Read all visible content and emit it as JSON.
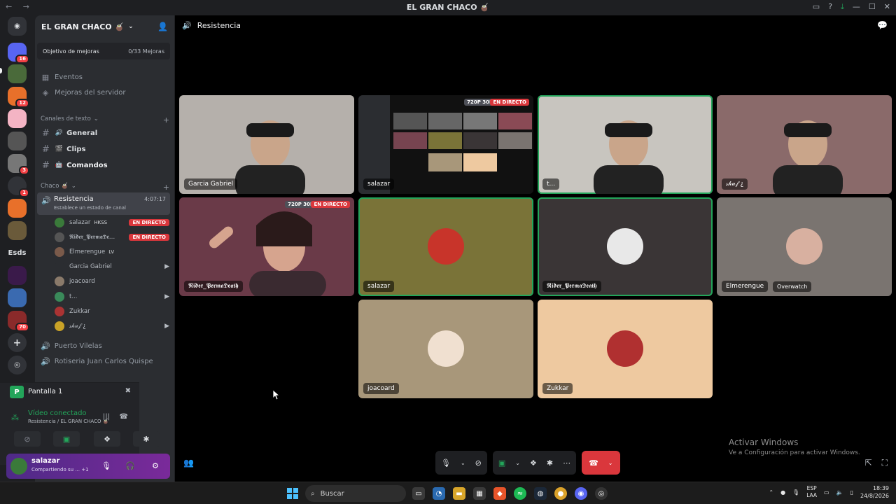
{
  "window": {
    "title": "EL GRAN CHACO 🧉",
    "nav": "← →"
  },
  "rail": {
    "badges": [
      "16",
      "12",
      "3",
      "1",
      "70"
    ],
    "text_server": "Esds"
  },
  "guild": {
    "name": "EL GRAN CHACO 🧉",
    "boost_label": "Objetivo de mejoras",
    "boost_progress": "0/33 Mejoras"
  },
  "sidebar": {
    "events": "Eventos",
    "boosts": "Mejoras del servidor",
    "text_category": "Canales de texto",
    "text_channels": [
      {
        "emoji": "🔊",
        "name": "General"
      },
      {
        "emoji": "🎬",
        "name": "Clips"
      },
      {
        "emoji": "🤖",
        "name": "Comandos"
      }
    ],
    "voice_category": "Chaco 🧉",
    "active_voice": {
      "name": "Resistencia",
      "status": "Establece un estado de canal",
      "timer": "4:07:17"
    },
    "members": [
      {
        "name": "salazar",
        "extra": "HKSS",
        "state": "EN DIRECTO",
        "color": "#3a7a3a"
      },
      {
        "name": "𝕽𝖎𝖉𝖊𝖗_𝕻𝖊𝖗𝖒𝖆𝕯𝖊…",
        "extra": "",
        "state": "EN DIRECTO",
        "color": "#555"
      },
      {
        "name": "Elmerengue",
        "extra": "LV",
        "state": "",
        "color": "#7a5a4a"
      },
      {
        "name": "Garcia Gabriel",
        "extra": "",
        "state": "cam",
        "color": "#2b2d31"
      },
      {
        "name": "joacoard",
        "extra": "",
        "state": "",
        "color": "#8a7a6a"
      },
      {
        "name": "t...",
        "extra": "",
        "state": "cam",
        "color": "#3a8a5a"
      },
      {
        "name": "Zukkar",
        "extra": "",
        "state": "",
        "color": "#a33"
      },
      {
        "name": "𝓈𝒽𝓊𝒻 ¿",
        "extra": "",
        "state": "cam",
        "color": "#c9a227"
      }
    ],
    "other_voice": [
      "Puerto Vilelas",
      "Rotiseria Juan Carlos Quispe"
    ]
  },
  "screen_panel": {
    "letter": "P",
    "label": "Pantalla 1"
  },
  "voice_panel": {
    "status": "Vídeo conectado",
    "location": "Resistencia / EL GRAN CHACO 🧉"
  },
  "user": {
    "name": "salazar",
    "status": "Compartiendo su ...",
    "extra": "+1"
  },
  "stage": {
    "channel": "Resistencia",
    "tiles": [
      {
        "name": "Garcia Gabriel",
        "kind": "cam",
        "bg": "#b5b0ab"
      },
      {
        "name": "salazar",
        "kind": "stream",
        "quality": "720P 30FPS",
        "live": "EN DIRECTO",
        "bg": "#111"
      },
      {
        "name": "t...",
        "kind": "cam",
        "bg": "#c8c5bf"
      },
      {
        "name": "𝓈𝒽𝓊𝒻 ¿",
        "kind": "cam",
        "bg": "#8a6a6a"
      },
      {
        "name": "𝕽𝖎𝖉𝖊𝖗_𝕻𝖊𝖗𝖒𝖆𝕯𝖊𝖆𝖙𝖍",
        "kind": "stream",
        "quality": "720P 30FPS",
        "live": "EN DIRECTO",
        "bg": "#6a3a48"
      },
      {
        "name": "salazar",
        "kind": "avatar",
        "bg": "#7a7338"
      },
      {
        "name": "𝕽𝖎𝖉𝖊𝖗_𝕻𝖊𝖗𝖒𝖆𝕯𝖊𝖆𝖙𝖍",
        "kind": "avatar",
        "bg": "#3a3536"
      },
      {
        "name": "Elmerengue",
        "kind": "avatar",
        "activity": "Overwatch",
        "bg": "#7a7470"
      },
      {
        "name": "joacoard",
        "kind": "avatar",
        "bg": "#a8977a"
      },
      {
        "name": "Zukkar",
        "kind": "avatar",
        "bg": "#eec9a0"
      }
    ]
  },
  "watermark": {
    "line1": "Activar Windows",
    "line2": "Ve a Configuración para activar Windows."
  },
  "taskbar": {
    "search": "Buscar",
    "lang1": "ESP",
    "lang2": "LAA",
    "time": "18:39",
    "date": "24/8/2026"
  }
}
